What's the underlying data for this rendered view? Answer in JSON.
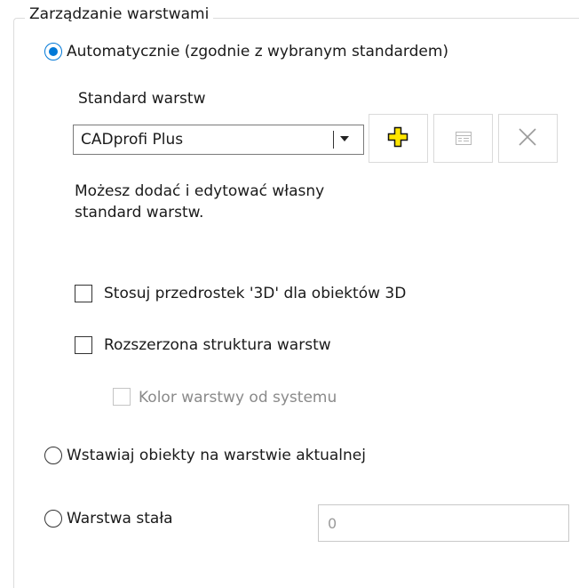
{
  "group": {
    "title": "Zarządzanie warstwami"
  },
  "mode_auto": {
    "label": "Automatycznie (zgodnie z wybranym standardem)",
    "selected": true
  },
  "standard": {
    "label": "Standard warstw",
    "selected_value": "CADprofi Plus",
    "hint_line1": "Możesz dodać i edytować własny",
    "hint_line2": "standard warstw."
  },
  "toolbar": {
    "add_icon": "plus-icon",
    "edit_icon": "edit-icon",
    "delete_icon": "delete-x-icon"
  },
  "options": {
    "prefix_3d": {
      "label": "Stosuj przedrostek '3D' dla obiektów 3D",
      "checked": false
    },
    "extended": {
      "label": "Rozszerzona struktura warstw",
      "checked": false
    },
    "system_color": {
      "label": "Kolor warstwy od systemu",
      "checked": false,
      "disabled": true
    }
  },
  "mode_current": {
    "label": "Wstawiaj obiekty na warstwie aktualnej",
    "selected": false
  },
  "mode_fixed": {
    "label": "Warstwa stała",
    "selected": false,
    "value": "0"
  },
  "colors": {
    "accent": "#0078d7",
    "add_icon_fill": "#ffe600"
  }
}
